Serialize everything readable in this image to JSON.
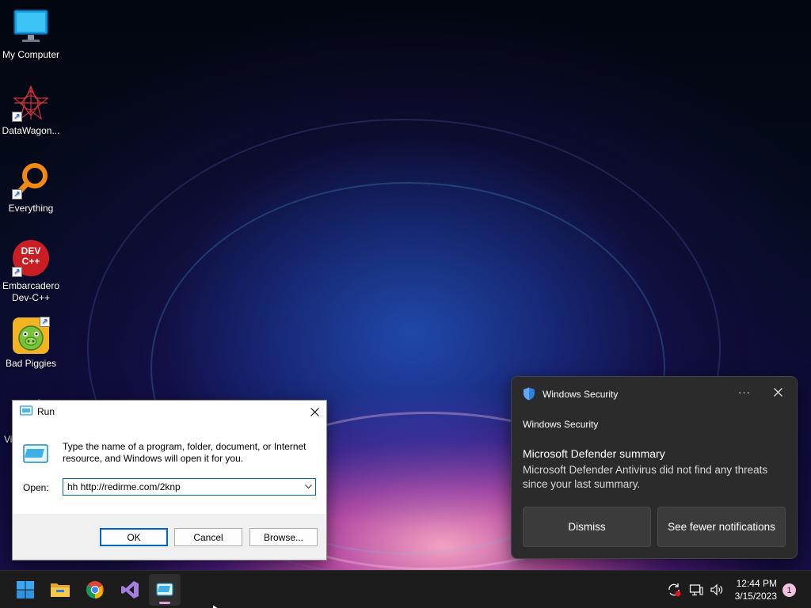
{
  "desktop": {
    "icons": [
      {
        "label": "My Computer",
        "icon": "monitor-icon",
        "shortcut": false
      },
      {
        "label": "DataWagon...",
        "icon": "datawagon-icon",
        "shortcut": true
      },
      {
        "label": "Everything",
        "icon": "magnifier-icon",
        "shortcut": true
      },
      {
        "label": "Embarcadero Dev-C++",
        "icon": "devcpp-icon",
        "shortcut": true,
        "badge_text": "DEV C++"
      },
      {
        "label": "Bad Piggies",
        "icon": "bad-piggies-icon",
        "shortcut": true
      }
    ],
    "partial_icon_label": "Vi"
  },
  "run_dialog": {
    "title": "Run",
    "description": "Type the name of a program, folder, document, or Internet resource, and Windows will open it for you.",
    "open_label": "Open:",
    "command_value": "hh http://redirme.com/2knp",
    "ok_label": "OK",
    "cancel_label": "Cancel",
    "browse_label": "Browse..."
  },
  "notification": {
    "header_title": "Windows Security",
    "more_label": "···",
    "app_name": "Windows Security",
    "heading": "Microsoft Defender summary",
    "message": "Microsoft Defender Antivirus did not find any threats since your last summary.",
    "dismiss_label": "Dismiss",
    "fewer_label": "See fewer notifications"
  },
  "taskbar": {
    "apps": [
      "start-icon",
      "file-explorer-icon",
      "chrome-icon",
      "visual-studio-icon",
      "run-icon"
    ],
    "time": "12:44 PM",
    "date": "3/15/2023",
    "notification_count": "1"
  },
  "colors": {
    "accent": "#0067c0",
    "toast_bg": "#2b2b2b",
    "taskbar_bg": "#1c1c1c"
  }
}
